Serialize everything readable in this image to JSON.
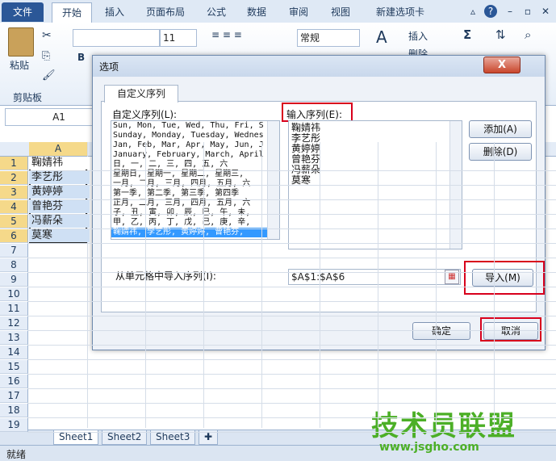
{
  "ribbon": {
    "tabs": [
      "文件",
      "开始",
      "插入",
      "页面布局",
      "公式",
      "数据",
      "审阅",
      "视图",
      "新建选项卡"
    ],
    "paste_label": "粘贴",
    "clipboard_label": "剪贴板",
    "font_size": "11",
    "number_format": "常规",
    "insert_label": "插入",
    "delete_label": "删除",
    "sigma": "Σ"
  },
  "namebox": "A1",
  "sheet": {
    "column_header": "A",
    "rows": [
      "1",
      "2",
      "3",
      "4",
      "5",
      "6",
      "7",
      "8",
      "9",
      "10",
      "11",
      "12",
      "13",
      "14",
      "15",
      "16",
      "17",
      "18",
      "19"
    ],
    "cells": [
      "鞠婧祎",
      "李艺彤",
      "黄婷婷",
      "曾艳芬",
      "冯薪朵",
      "莫寒"
    ]
  },
  "sheet_tabs": [
    "Sheet1",
    "Sheet2",
    "Sheet3"
  ],
  "status": "就绪",
  "dialog": {
    "title": "选项",
    "close": "X",
    "tab": "自定义序列",
    "custom_lists_label": "自定义序列(L):",
    "custom_lists": [
      "Sun, Mon, Tue, Wed, Thu, Fri, S",
      "Sunday, Monday, Tuesday, Wednes",
      "Jan, Feb, Mar, Apr, May, Jun, J",
      "January, February, March, April",
      "日, 一, 二, 三, 四, 五, 六",
      "星期日, 星期一, 星期二, 星期三,",
      "一月, 二月, 三月, 四月, 五月, 六",
      "第一季, 第二季, 第三季, 第四季",
      "正月, 二月, 三月, 四月, 五月, 六",
      "子, 丑, 寅, 卯, 辰, 巳, 午, 未,",
      "甲, 乙, 丙, 丁, 戊, 己, 庚, 辛,",
      "鞠婧祎, 李艺彤, 黄婷婷, 曾艳芬,"
    ],
    "entries_label": "输入序列(E):",
    "entries": [
      "鞠婧祎",
      "李艺彤",
      "黄婷婷",
      "曾艳芬",
      "冯薪朵",
      "莫寒"
    ],
    "add": "添加(A)",
    "delete": "删除(D)",
    "import_label": "从单元格中导入序列(I):",
    "import_range": "$A$1:$A$6",
    "import_btn": "导入(M)",
    "ok": "确定",
    "cancel": "取消"
  },
  "watermark": {
    "text": "技术员联盟",
    "url": "www.jsgho.com"
  },
  "colors": {
    "highlight": "#d8001c",
    "selection": "#3399ff",
    "file_tab": "#2b5797"
  }
}
